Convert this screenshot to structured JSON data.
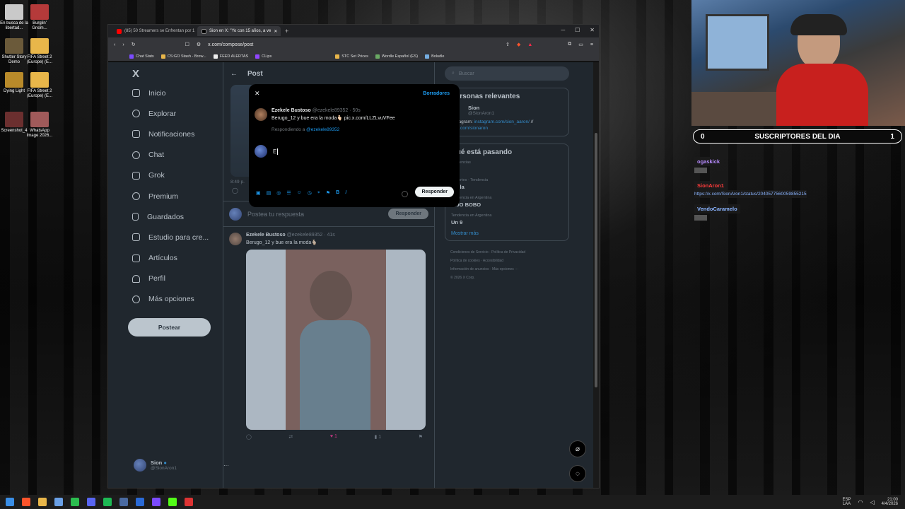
{
  "desktop": {
    "icons": [
      {
        "label": "En busca de la libertad..."
      },
      {
        "label": "Burglin' Gnom..."
      },
      {
        "label": "Shutter Story Demo"
      },
      {
        "label": "FIFA Street 2 (Europe) (E..."
      },
      {
        "label": "Dying Light"
      },
      {
        "label": "FIFA Street 2 (Europe) (E..."
      },
      {
        "label": "Screenshot_4"
      },
      {
        "label": "WhatsApp Image 2026..."
      }
    ]
  },
  "browser": {
    "tabs": [
      {
        "label": "(85) 50 Streamers se Enfrentan por 1"
      },
      {
        "label": "Sion en X: \"Yo con 15 años, a ve"
      }
    ],
    "new_tab": "+",
    "url": "x.com/compose/post",
    "bookmarks": [
      "Chat Stats",
      "CS:GO Stash - Brow...",
      "FEED ALERTAS",
      "CLips",
      "STC Set Prices",
      "Wordle Español (ES)",
      "Boludle"
    ]
  },
  "nav": {
    "logo": "X",
    "items": [
      "Inicio",
      "Explorar",
      "Notificaciones",
      "Chat",
      "Grok",
      "Premium",
      "Guardados",
      "Estudio para cre...",
      "Artículos",
      "Perfil",
      "Más opciones"
    ],
    "post_button": "Postear",
    "profile_name": "Sion",
    "profile_handle": "@SionAron1",
    "profile_more": "···"
  },
  "main": {
    "back": "←",
    "title": "Post",
    "timestamp_partial": "8:49 p.",
    "reply_placeholder": "Postea tu respuesta",
    "reply_button": "Responder",
    "tweet": {
      "author": "Ezekele Bustoso",
      "handle": "@ezekele89352 · 41s",
      "text": "Berugo_12 y bue era la moda🫰🏻",
      "likes": "1",
      "views": "1"
    }
  },
  "right": {
    "search_placeholder": "Buscar",
    "relevant_title": "Personas relevantes",
    "relevant_name": "Sion",
    "relevant_handle": "@SionAron1",
    "relevant_bio_prefix": "Instagram:",
    "relevant_bio_link1": "instagram.com/sion_aaron/",
    "relevant_bio_sep": "//",
    "relevant_bio_link2": "kick.com/sionaron",
    "happening_title": "Qué está pasando",
    "trends": [
      {
        "meta": "Tendencias",
        "name": "o"
      },
      {
        "meta": "Deportes · Tendencia",
        "name": "avilla"
      },
      {
        "meta": "Tendencia en Argentina",
        "name": "HIJO BOBO"
      },
      {
        "meta": "Tendencia en Argentina",
        "name": "Un 9"
      }
    ],
    "show_more": "Mostrar más",
    "footer": [
      "Condiciones de Servicio",
      "Política de Privacidad",
      "Política de cookies",
      "Accesibilidad",
      "Información de anuncios",
      "Más opciones ···",
      "© 2026 X Corp."
    ]
  },
  "modal": {
    "close": "✕",
    "drafts": "Borradores",
    "quoted_author": "Ezekele Bustoso",
    "quoted_handle": "@ezekele89352 · 50s",
    "quoted_text": "Berugo_12 y bue era la moda🫰🏻",
    "quoted_link": "pic.x.com/LLZLvuVFee",
    "replying_prefix": "Respondiendo a",
    "replying_to": "@ezekele89352",
    "draft_text": "E",
    "reply_button": "Responder"
  },
  "stream": {
    "subs_left": "0",
    "subs_title": "SUSCRIPTORES DEL DIA",
    "subs_right": "1",
    "chat": [
      {
        "user": "ogaskick",
        "color": "#b78bff",
        "text": ""
      },
      {
        "user": "SionAron1",
        "color": "#ff3b3b",
        "text": "https://x.com/SionAron1/status/2040577560059855215"
      },
      {
        "user": "VendoCaramelo",
        "color": "#8ab4ff",
        "text": ""
      }
    ]
  },
  "taskbar": {
    "lang": "ESP",
    "lang2": "LAA",
    "time": "21:00",
    "date": "4/4/2026"
  }
}
